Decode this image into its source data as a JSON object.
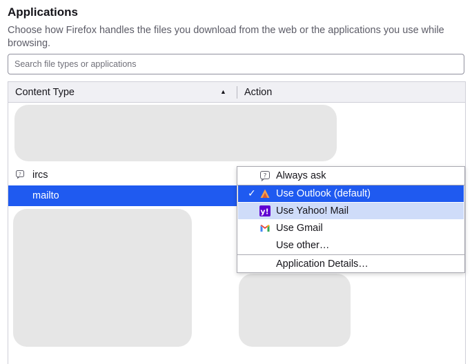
{
  "section": {
    "title": "Applications",
    "description": "Choose how Firefox handles the files you download from the web or the applications you use while browsing."
  },
  "search": {
    "placeholder": "Search file types or applications",
    "value": ""
  },
  "table": {
    "columns": [
      "Content Type",
      "Action"
    ],
    "sort": "ascending",
    "rows": [
      {
        "label": "ircs",
        "icon": "question-bubble-icon",
        "selected": false
      },
      {
        "label": "mailto",
        "selected": true
      }
    ]
  },
  "action_menu": {
    "items": [
      {
        "label": "Always ask",
        "icon": "question-bubble-icon",
        "state": "normal"
      },
      {
        "label": "Use Outlook (default)",
        "icon": "outlook-icon",
        "state": "selected",
        "checked": true
      },
      {
        "label": "Use Yahoo! Mail",
        "icon": "yahoo-icon",
        "state": "hover"
      },
      {
        "label": "Use Gmail",
        "icon": "gmail-icon",
        "state": "normal"
      },
      {
        "label": "Use other…",
        "state": "normal"
      },
      {
        "label": "Application Details…",
        "state": "normal"
      }
    ]
  },
  "colors": {
    "selection": "#1f5af0",
    "hover": "#cfdcf9",
    "redaction": "#e6e6e6",
    "yahoo": "#6001d2"
  }
}
